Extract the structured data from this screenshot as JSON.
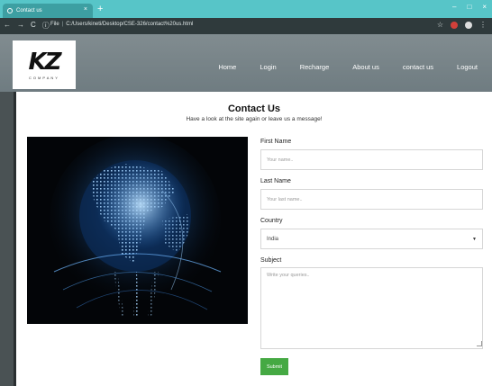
{
  "browser": {
    "tab_title": "Contact us",
    "tab_close": "×",
    "new_tab": "+",
    "url_label": "File",
    "url": "C:/Users/kineti/Desktop/CSE-326/contact%20us.html",
    "back": "←",
    "forward": "→",
    "reload": "C",
    "info": "ⓘ",
    "star": "☆",
    "menu": "⋮",
    "minimize": "–",
    "maximize": "□",
    "close": "×"
  },
  "site": {
    "logo": {
      "mark": "KZ",
      "sub": "COMPANY"
    },
    "nav": [
      "Home",
      "Login",
      "Recharge",
      "About us",
      "contact us",
      "Logout"
    ]
  },
  "page": {
    "title": "Contact Us",
    "subtitle": "Have a look at the site again or leave us a message!"
  },
  "form": {
    "first_name": {
      "label": "First Name",
      "placeholder": "Your name.."
    },
    "last_name": {
      "label": "Last Name",
      "placeholder": "Your last name.."
    },
    "country": {
      "label": "Country",
      "value": "India",
      "caret": "▼"
    },
    "subject": {
      "label": "Subject",
      "placeholder": "Write your queries.."
    },
    "submit": "Submit"
  },
  "colors": {
    "tabbar": "#57c5c8",
    "addressbar": "#2f3a3c",
    "header": "#7a868a",
    "submit": "#45a943"
  }
}
